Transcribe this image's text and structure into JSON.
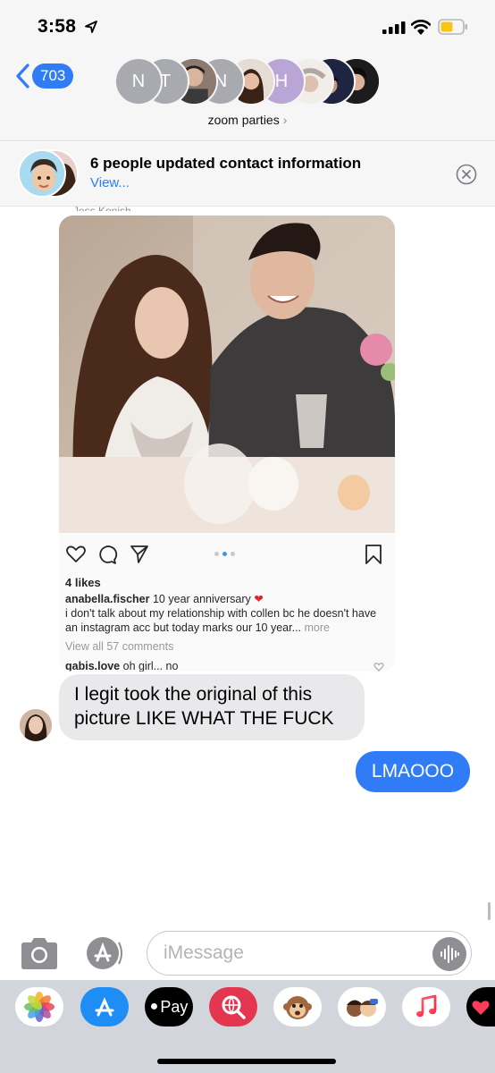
{
  "status_bar": {
    "time": "3:58"
  },
  "header": {
    "back_count": "703",
    "avatar_initials": [
      "N",
      "T",
      "N",
      "H"
    ],
    "group_name": "zoom parties",
    "group_chevron": "›"
  },
  "banner": {
    "title": "6 people updated contact information",
    "link": "View..."
  },
  "conversation": {
    "sender_name": "Jess Konish",
    "shared_post": {
      "likes": "4 likes",
      "username": "anabella.fischer",
      "caption_lead": "10 year anniversary",
      "caption_body": "i don't talk about my relationship with collen bc he doesn't have an instagram acc but today marks our 10 year...",
      "more": "more",
      "view_comments": "View all 57 comments",
      "comment_user": "gabis.love",
      "comment_text": "oh girl... no"
    },
    "incoming_message": "I legit took the original of this picture LIKE WHAT THE FUCK",
    "outgoing_message": "LMAOOO"
  },
  "input": {
    "placeholder": "iMessage"
  },
  "drawer": {
    "apple_pay_label": "Pay"
  },
  "colors": {
    "imessage_blue": "#2f7cf6",
    "incoming_bubble": "#e9e9eb",
    "drawer_bg": "#d2d5db"
  },
  "icons": [
    "location-arrow-icon",
    "signal-icon",
    "wifi-icon",
    "battery-icon",
    "chevron-left-icon",
    "close-circle-icon",
    "heart-icon",
    "comment-icon",
    "send-icon",
    "bookmark-icon",
    "camera-icon",
    "app-store-icon",
    "audio-waveform-icon",
    "photos-icon",
    "apple-pay-icon",
    "search-web-icon",
    "memoji-icon",
    "music-icon"
  ]
}
